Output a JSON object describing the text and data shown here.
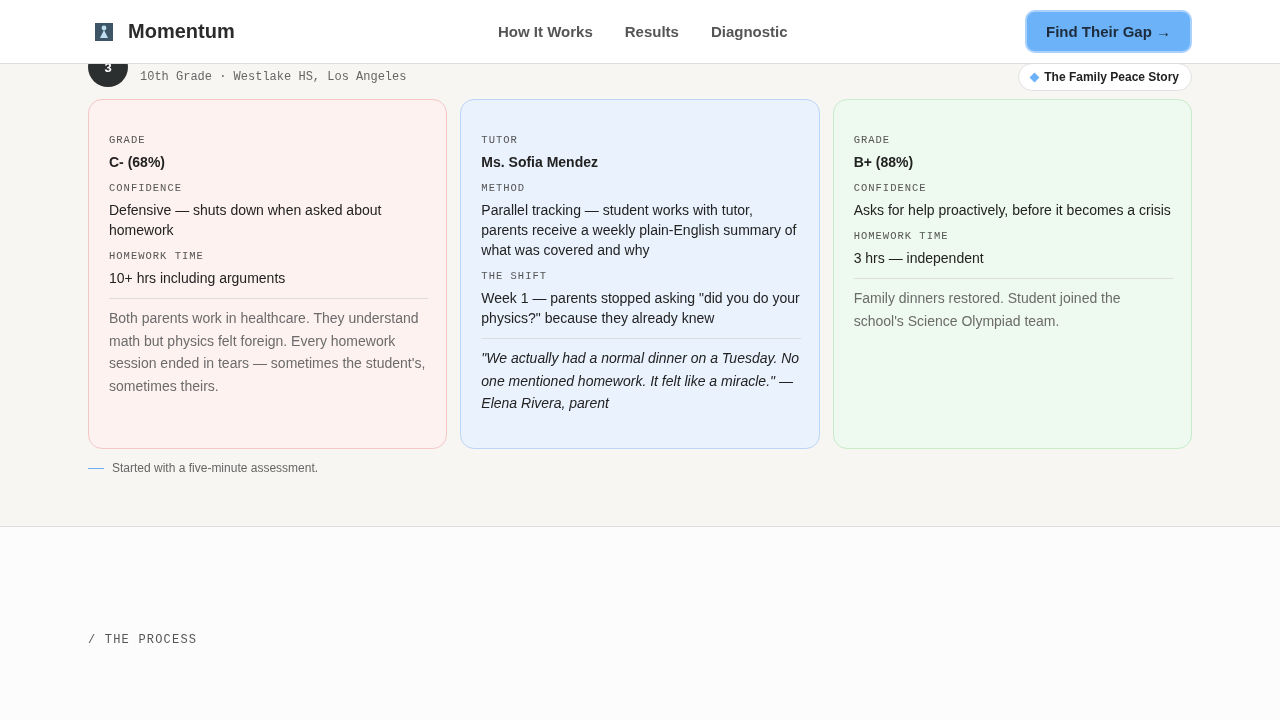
{
  "header": {
    "brand": "Momentum",
    "nav": [
      "How It Works",
      "Results",
      "Diagnostic"
    ],
    "cta": "Find Their Gap →"
  },
  "story": {
    "avatar": "3",
    "meta": "10th Grade · Westlake HS, Los Angeles",
    "badge": "The Family Peace Story"
  },
  "cards": [
    {
      "kind": "before",
      "fields": [
        {
          "label": "GRADE",
          "value": "C- (68%)",
          "kind": "headline"
        },
        {
          "label": "CONFIDENCE",
          "value": "Defensive — shuts down when asked about homework",
          "kind": "detail"
        },
        {
          "label": "HOMEWORK TIME",
          "value": "10+ hrs including arguments",
          "kind": "detail"
        }
      ],
      "note": {
        "kind": "plain",
        "text": "Both parents work in healthcare. They understand math but physics felt foreign. Every homework session ended in tears — sometimes the student's, sometimes theirs."
      }
    },
    {
      "kind": "during",
      "fields": [
        {
          "label": "TUTOR",
          "value": "Ms. Sofia Mendez",
          "kind": "headline"
        },
        {
          "label": "METHOD",
          "value": "Parallel tracking — student works with tutor, parents receive a weekly plain-English summary of what was covered and why",
          "kind": "detail"
        },
        {
          "label": "THE SHIFT",
          "value": "Week 1 — parents stopped asking \"did you do your physics?\" because they already knew",
          "kind": "detail"
        }
      ],
      "note": {
        "kind": "quote",
        "text": "\"We actually had a normal dinner on a Tuesday. No one mentioned homework. It felt like a miracle.\" — Elena Rivera, parent"
      }
    },
    {
      "kind": "after",
      "fields": [
        {
          "label": "GRADE",
          "value": "B+ (88%)",
          "kind": "headline"
        },
        {
          "label": "CONFIDENCE",
          "value": "Asks for help proactively, before it becomes a crisis",
          "kind": "detail"
        },
        {
          "label": "HOMEWORK TIME",
          "value": "3 hrs — independent",
          "kind": "detail"
        }
      ],
      "note": {
        "kind": "plain",
        "text": "Family dinners restored. Student joined the school's Science Olympiad team."
      }
    }
  ],
  "footnote": "Started with a five-minute assessment.",
  "process": {
    "eyebrow": "/ THE PROCESS"
  }
}
